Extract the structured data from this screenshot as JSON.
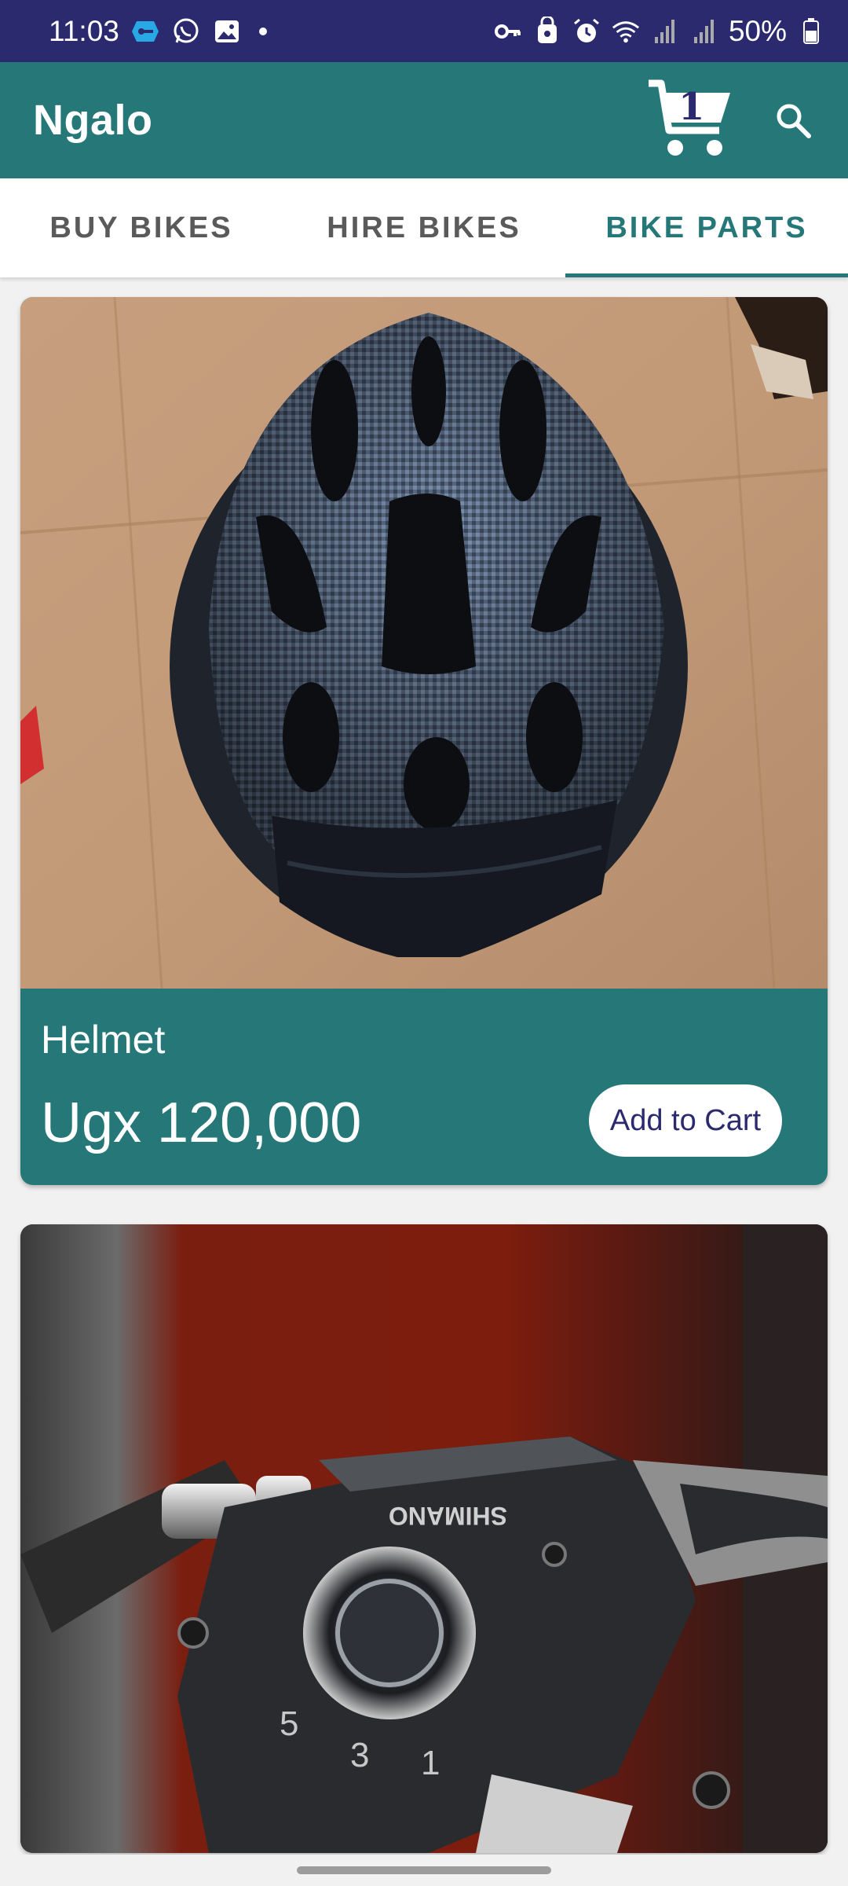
{
  "status_bar": {
    "time": "11:03",
    "battery": "50%",
    "background": "#2b2a6e"
  },
  "app_bar": {
    "title": "Ngalo",
    "cart_count": "1",
    "color": "#267878"
  },
  "tabs": [
    {
      "label": "BUY BIKES",
      "active": false
    },
    {
      "label": "HIRE BIKES",
      "active": false
    },
    {
      "label": "BIKE PARTS",
      "active": true
    }
  ],
  "products": [
    {
      "name": "Helmet",
      "price": "Ugx 120,000",
      "button_label": "Add to Cart",
      "image": "bicycle-helmet-photo"
    },
    {
      "image": "shimano-gear-shifter-photo",
      "shifter_text": "SHIMANO"
    }
  ]
}
